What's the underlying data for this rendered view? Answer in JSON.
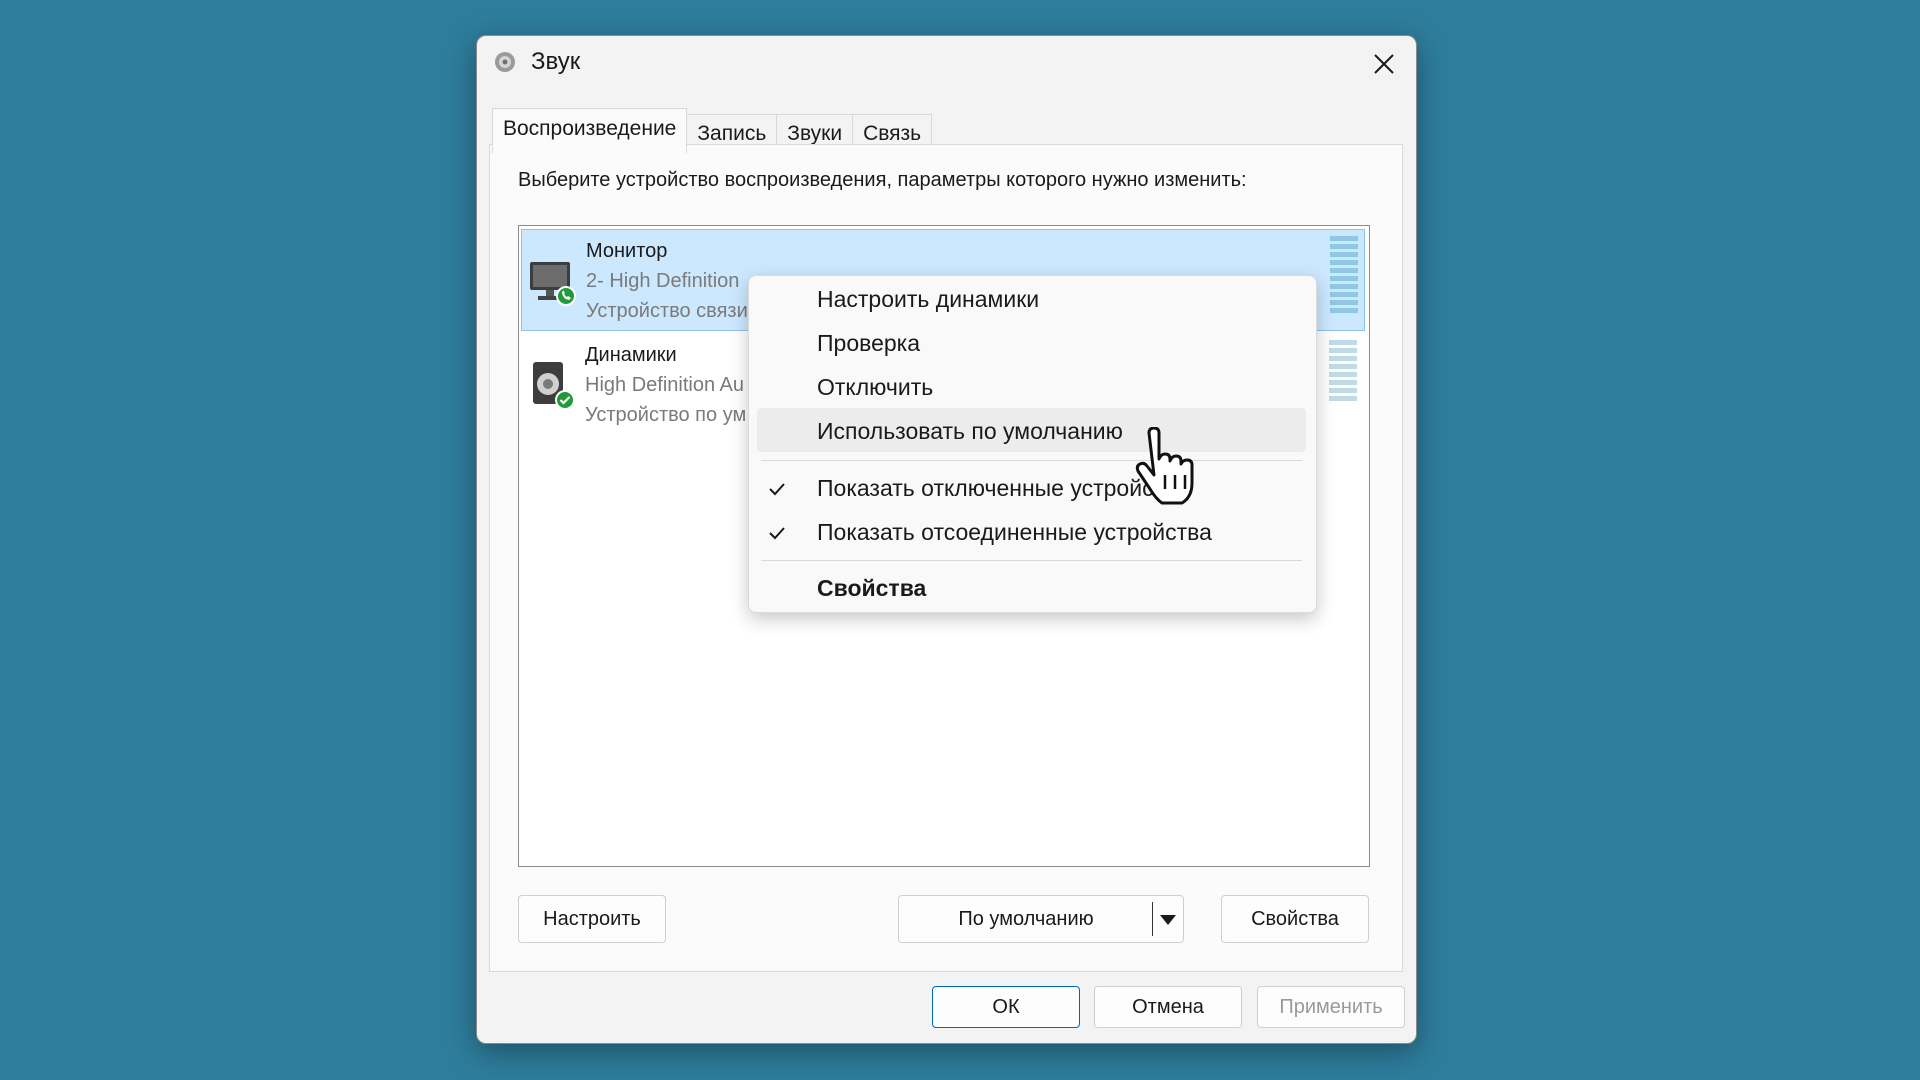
{
  "window": {
    "title": "Звук",
    "close_label": "close"
  },
  "tabs": [
    {
      "label": "Воспроизведение",
      "active": true
    },
    {
      "label": "Запись",
      "active": false
    },
    {
      "label": "Звуки",
      "active": false
    },
    {
      "label": "Связь",
      "active": false
    }
  ],
  "instruction": "Выберите устройство воспроизведения, параметры которого нужно изменить:",
  "devices": [
    {
      "name": "Монитор",
      "line1": "2- High Definition",
      "line2": "Устройство связи",
      "selected": true,
      "icon": "monitor-icon",
      "status_icon": "phone-badge-icon"
    },
    {
      "name": "Динамики",
      "line1": "High Definition Au",
      "line2": "Устройство по ум",
      "selected": false,
      "icon": "speaker-icon",
      "status_icon": "check-badge-icon"
    }
  ],
  "buttons": {
    "configure": "Настроить",
    "set_default": "По умолчанию",
    "properties": "Свойства",
    "ok": "ОК",
    "cancel": "Отмена",
    "apply": "Применить"
  },
  "context_menu": {
    "items": [
      {
        "label": "Настроить динамики"
      },
      {
        "label": "Проверка"
      },
      {
        "label": "Отключить"
      },
      {
        "label": "Использовать по умолчанию",
        "hovered": true
      },
      {
        "label": "Показать отключенные устройства",
        "checked": true
      },
      {
        "label": "Показать отсоединенные устройства",
        "checked": true
      },
      {
        "label": "Свойства",
        "bold": true
      }
    ]
  },
  "colors": {
    "desktop": "#2e7d9c",
    "selection": "#cce8ff",
    "accent": "#0067c0",
    "badge_green": "#1f9b3c",
    "meter": "#8fc7e5"
  }
}
